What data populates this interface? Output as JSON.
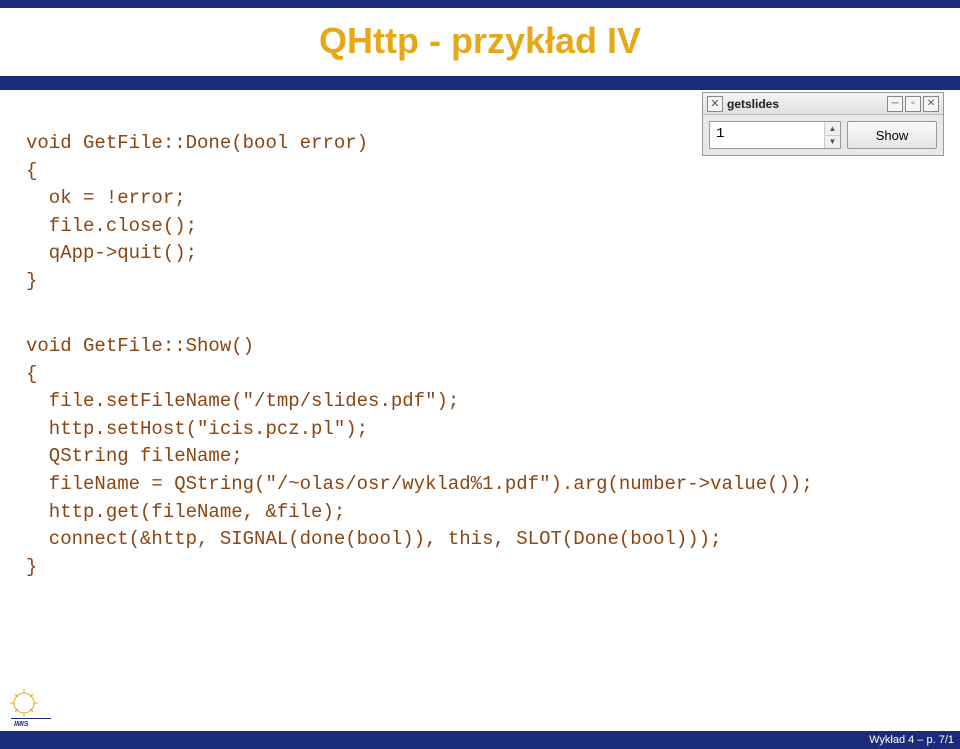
{
  "title": "QHttp - przykład IV",
  "code_block_1": "void GetFile::Done(bool error)\n{\n  ok = !error;\n  file.close();\n  qApp->quit();\n}",
  "code_block_2": "void GetFile::Show()\n{\n  file.setFileName(\"/tmp/slides.pdf\");\n  http.setHost(\"icis.pcz.pl\");\n  QString fileName;\n  fileName = QString(\"/~olas/osr/wyklad%1.pdf\").arg(number->value());\n  http.get(fileName, &file);\n  connect(&http, SIGNAL(done(bool)), this, SLOT(Done(bool)));\n}",
  "widget": {
    "title": "getslides",
    "value": "1",
    "button_label": "Show",
    "close_glyph": "✕",
    "min_glyph": "─",
    "restore_glyph": "▫",
    "max_glyph": "✕",
    "up_glyph": "▲",
    "down_glyph": "▼"
  },
  "footer": "Wykład 4 – p. 7/1"
}
